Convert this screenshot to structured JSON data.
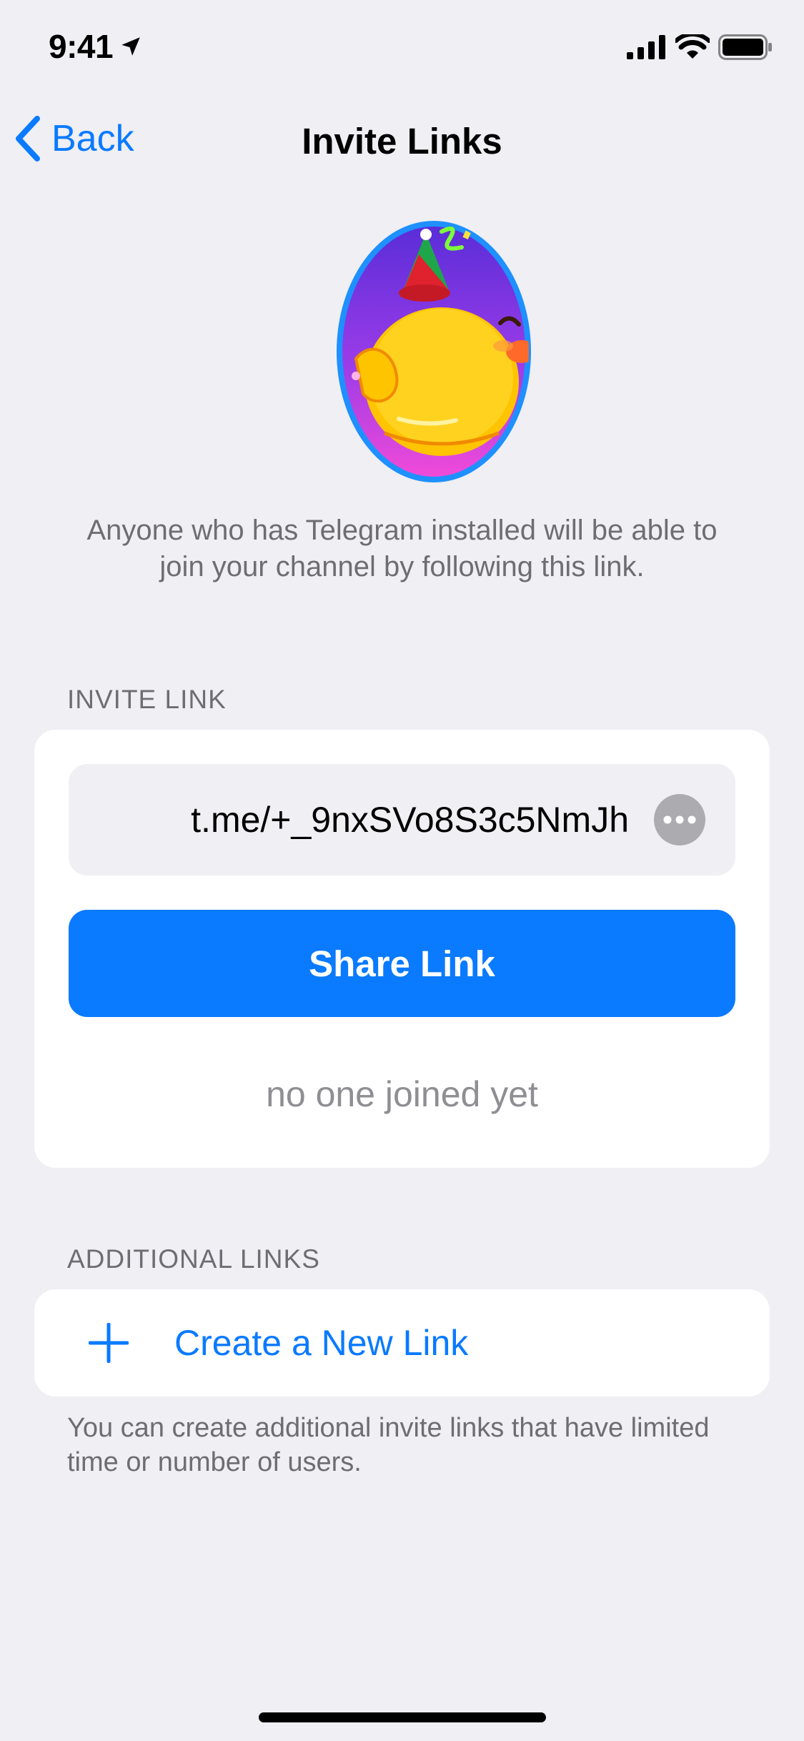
{
  "status_bar": {
    "time": "9:41",
    "location_icon": "location-arrow-icon",
    "signal_icon": "cellular-signal-icon",
    "wifi_icon": "wifi-icon",
    "battery_icon": "battery-icon"
  },
  "nav": {
    "back_label": "Back",
    "title": "Invite Links"
  },
  "sticker": {
    "icon": "party-duck-sticker"
  },
  "description": "Anyone who has Telegram installed will be able to join your channel by following this link.",
  "invite_section": {
    "header": "INVITE LINK",
    "link": "t.me/+_9nxSVo8S3c5NmJh",
    "share_label": "Share Link",
    "joined_status": "no one joined yet"
  },
  "additional_section": {
    "header": "ADDITIONAL LINKS",
    "create_label": "Create a New Link",
    "footer": "You can create additional invite links that have limited time or number of users."
  },
  "colors": {
    "accent": "#0A7AFF",
    "background": "#EFEFF4",
    "card": "#FFFFFF",
    "secondary_text": "#6D6D72"
  }
}
